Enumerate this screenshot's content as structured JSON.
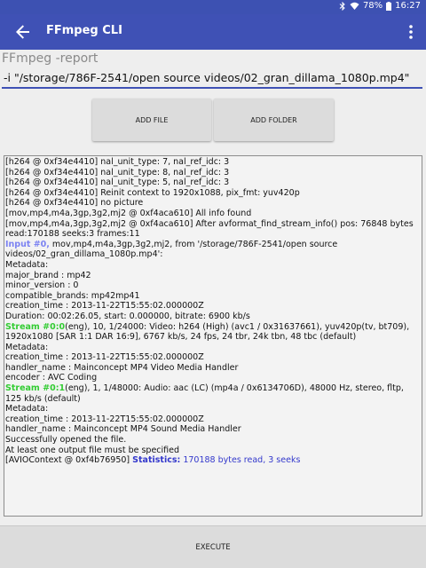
{
  "status_bar": {
    "battery": "78%",
    "time": "16:27",
    "icons": [
      "bluetooth-icon",
      "wifi-icon",
      "battery-icon"
    ]
  },
  "app_bar": {
    "title": "FFmpeg CLI",
    "back_icon": "arrow-back-icon",
    "menu_icon": "more-vert-icon"
  },
  "command": {
    "label": "FFmpeg -report",
    "value": "-i \"/storage/786F-2541/open source videos/02_gran_dillama_1080p.mp4\""
  },
  "buttons": {
    "add_file": "ADD FILE",
    "add_folder": "ADD FOLDER",
    "execute": "EXECUTE"
  },
  "log": {
    "lines": [
      "[h264 @ 0xf34e4410] nal_unit_type: 7, nal_ref_idc: 3",
      "[h264 @ 0xf34e4410] nal_unit_type: 8, nal_ref_idc: 3",
      "[h264 @ 0xf34e4410] nal_unit_type: 5, nal_ref_idc: 3",
      "[h264 @ 0xf34e4410] Reinit context to 1920x1088, pix_fmt: yuv420p",
      "[h264 @ 0xf34e4410] no picture",
      "[mov,mp4,m4a,3gp,3g2,mj2 @ 0xf4aca610] All info found",
      "[mov,mp4,m4a,3gp,3g2,mj2 @ 0xf4aca610] After avformat_find_stream_info() pos: 76848 bytes read:170188 seeks:3 frames:11"
    ],
    "input_prefix": "Input #0,",
    "input_rest": " mov,mp4,m4a,3gp,3g2,mj2, from '/storage/786F-2541/open source videos/02_gran_dillama_1080p.mp4':",
    "meta_lines": [
      "Metadata:",
      "major_brand : mp42",
      "minor_version : 0",
      "compatible_brands: mp42mp41",
      "creation_time : 2013-11-22T15:55:02.000000Z",
      "Duration: 00:02:26.05, start: 0.000000, bitrate: 6900 kb/s"
    ],
    "stream0_prefix": "Stream #0:0",
    "stream0_rest": "(eng), 10, 1/24000: Video: h264 (High) (avc1 / 0x31637661), yuv420p(tv, bt709), 1920x1080 [SAR 1:1 DAR 16:9], 6767 kb/s, 24 fps, 24 tbr, 24k tbn, 48 tbc (default)",
    "stream0_meta": [
      "Metadata:",
      "creation_time : 2013-11-22T15:55:02.000000Z",
      "handler_name : Mainconcept MP4 Video Media Handler",
      "encoder : AVC Coding"
    ],
    "stream1_prefix": "Stream #0:1",
    "stream1_rest": "(eng), 1, 1/48000: Audio: aac (LC) (mp4a / 0x6134706D), 48000 Hz, stereo, fltp, 125 kb/s (default)",
    "stream1_meta": [
      "Metadata:",
      "creation_time : 2013-11-22T15:55:02.000000Z",
      "handler_name : Mainconcept MP4 Sound Media Handler",
      "Successfully opened the file.",
      "At least one output file must be specified"
    ],
    "final_prefix": "[AVIOContext @ 0xf4b76950] ",
    "final_stats_label": "Statistics:",
    "final_stats_value": " 170188 bytes read, 3 seeks"
  },
  "colors": {
    "primary": "#3f51b5",
    "status_bar": "#3d51b2",
    "input_highlight": "#7c83f2",
    "stream_highlight": "#33cc33",
    "stats_highlight": "#3338cc"
  }
}
